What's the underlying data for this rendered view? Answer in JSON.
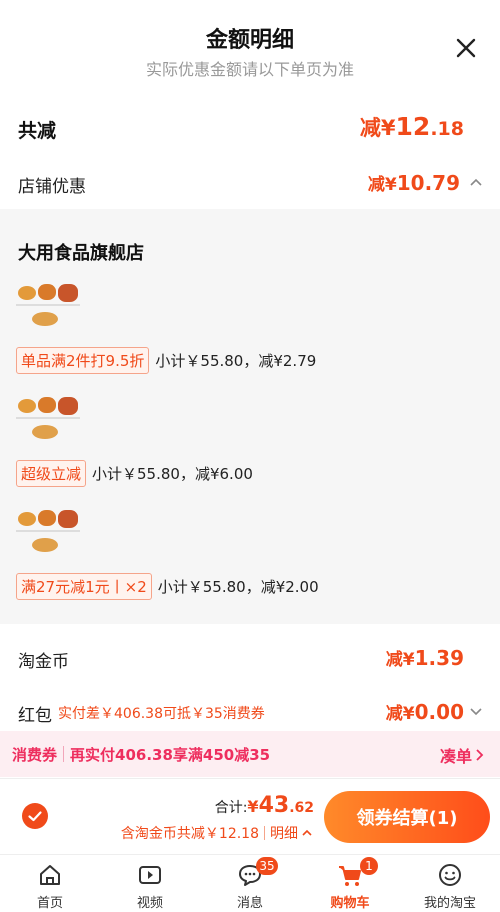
{
  "header": {
    "title": "金额明细",
    "subtitle": "实际优惠金额请以下单页为准"
  },
  "total": {
    "label": "共减",
    "prefix": "减¥",
    "integer": "12",
    "decimal": ".18"
  },
  "shop_discount": {
    "label": "店铺优惠",
    "prefix": "减¥",
    "amount": "10.79"
  },
  "store": {
    "name": "大用食品旗舰店",
    "promos": [
      {
        "tag": "单品满2件打9.5折",
        "text": "小计￥55.80，减¥2.79"
      },
      {
        "tag": "超级立减",
        "text": "小计￥55.80，减¥6.00"
      },
      {
        "tag": "满27元减1元丨×2",
        "text": "小计￥55.80，减¥2.00"
      }
    ]
  },
  "taojinbi": {
    "label": "淘金币",
    "prefix": "减¥",
    "amount": "1.39"
  },
  "hongbao": {
    "label": "红包",
    "note": "实付差￥406.38可抵￥35消费券",
    "prefix": "减¥",
    "amount": "0.00"
  },
  "coupon_bar": {
    "label": "消费券",
    "message": "再实付406.38享满450减35",
    "action": "凑单"
  },
  "checkout": {
    "sum_label": "合计:",
    "currency": "¥",
    "integer": "43",
    "decimal": ".62",
    "saving_text": "含淘金币共减￥12.18",
    "detail_label": "明细",
    "pay_button": "领券结算(1)"
  },
  "tabbar": [
    {
      "label": "首页",
      "icon": "home-icon"
    },
    {
      "label": "视频",
      "icon": "video-icon"
    },
    {
      "label": "消息",
      "icon": "message-icon",
      "badge": "35"
    },
    {
      "label": "购物车",
      "icon": "cart-icon",
      "badge": "1",
      "active": true
    },
    {
      "label": "我的淘宝",
      "icon": "profile-icon"
    }
  ],
  "colors": {
    "accent": "#f04a1a",
    "coupon": "#ee2e5e"
  }
}
